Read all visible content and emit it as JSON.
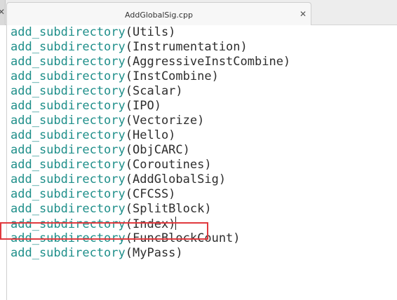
{
  "tab": {
    "title": "AddGlobalSig.cpp",
    "close_glyph": "✕",
    "new_glyph": "▾"
  },
  "left_stub": {
    "close_glyph": "✕"
  },
  "editor": {
    "lines": [
      {
        "cmd": "add_subdirectory",
        "arg": "(Utils)"
      },
      {
        "cmd": "add_subdirectory",
        "arg": "(Instrumentation)"
      },
      {
        "cmd": "add_subdirectory",
        "arg": "(AggressiveInstCombine)"
      },
      {
        "cmd": "add_subdirectory",
        "arg": "(InstCombine)"
      },
      {
        "cmd": "add_subdirectory",
        "arg": "(Scalar)"
      },
      {
        "cmd": "add_subdirectory",
        "arg": "(IPO)"
      },
      {
        "cmd": "add_subdirectory",
        "arg": "(Vectorize)"
      },
      {
        "cmd": "add_subdirectory",
        "arg": "(Hello)"
      },
      {
        "cmd": "add_subdirectory",
        "arg": "(ObjCARC)"
      },
      {
        "cmd": "add_subdirectory",
        "arg": "(Coroutines)"
      },
      {
        "cmd": "add_subdirectory",
        "arg": "(AddGlobalSig)"
      },
      {
        "cmd": "add_subdirectory",
        "arg": "(CFCSS)"
      },
      {
        "cmd": "add_subdirectory",
        "arg": "(SplitBlock)"
      },
      {
        "cmd": "add_subdirectory",
        "arg": "(Index)"
      },
      {
        "cmd": "add_subdirectory",
        "arg": "(FuncBlockCount)"
      },
      {
        "cmd": "add_subdirectory",
        "arg": "(MyPass)"
      }
    ]
  },
  "colors": {
    "keyword": "#1f8f8a",
    "text": "#2e2e2e",
    "highlight_border": "#e0393e"
  }
}
